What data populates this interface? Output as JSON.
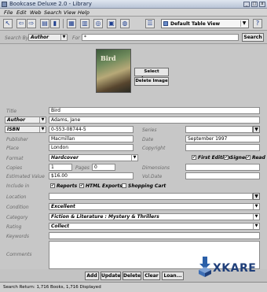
{
  "window": {
    "title": "Bookcase Deluxe 2.0 - Library",
    "min_symbol": "_",
    "max_symbol": "□",
    "close_symbol": "x"
  },
  "menu": [
    "File",
    "Edit",
    "Web",
    "Search",
    "View",
    "Help"
  ],
  "toolbar": {
    "buttons": [
      {
        "name": "pointer-icon",
        "glyph": "↖"
      },
      {
        "name": "back-arrow-icon",
        "glyph": "⇦"
      },
      {
        "name": "forward-arrow-icon",
        "glyph": "⇨"
      },
      {
        "name": "new-record-icon",
        "glyph": "▤"
      },
      {
        "name": "save-icon",
        "glyph": "▮"
      },
      {
        "name": "book-icon",
        "glyph": "▦"
      },
      {
        "name": "library-icon",
        "glyph": "▥"
      },
      {
        "name": "binoculars-icon",
        "glyph": "◎"
      },
      {
        "name": "stamp-icon",
        "glyph": "▣"
      },
      {
        "name": "web-icon",
        "glyph": "◍"
      },
      {
        "name": "list-icon",
        "glyph": "☰"
      },
      {
        "name": "help-icon",
        "glyph": "?"
      }
    ],
    "view_select": "Default Table View",
    "view_arrow": "▼"
  },
  "search": {
    "by_label": "Search By",
    "by_value": "Author",
    "for_label": "For",
    "for_value": "*",
    "button": "Search"
  },
  "cover": {
    "title_on_cover": "Bird",
    "select_button": "Select Image...",
    "delete_button": "Delete Image"
  },
  "form": {
    "title_label": "Title",
    "title_value": "Bird",
    "author_label": "Author",
    "author_value": "Adams, Jane",
    "isbn_label": "ISBN",
    "isbn_value": "0-553-08744-5",
    "series_label": "Series",
    "series_value": "",
    "publisher_label": "Publisher",
    "publisher_value": "Macmillan",
    "date_label": "Date",
    "date_value": "September 1997",
    "place_label": "Place",
    "place_value": "London",
    "copyright_label": "Copyright",
    "copyright_value": "",
    "format_label": "Format",
    "format_value": "Hardcover",
    "first_edition_label": "First Edition",
    "first_edition_checked": "✔",
    "signed_label": "Signed",
    "signed_checked": "✔",
    "read_label": "Read",
    "read_checked": "✔",
    "copies_label": "Copies",
    "copies_value": "1",
    "pages_label": "Pages",
    "pages_value": "0",
    "dimensions_label": "Dimensions",
    "dimensions_value": "",
    "estimated_label": "Estimated Value",
    "estimated_value": "$16.00",
    "voldate_label": "Vol.Date",
    "voldate_value": "",
    "include_label": "Include in",
    "reports_label": "Reports",
    "reports_checked": "✔",
    "html_label": "HTML Exports",
    "html_checked": "✔",
    "cart_label": "Shopping Cart",
    "cart_checked": "",
    "location_label": "Location",
    "location_value": "",
    "condition_label": "Condition",
    "condition_value": "Excellent",
    "category_label": "Category",
    "category_value": "Fiction & Literature : Mystery & Thrillers",
    "rating_label": "Rating",
    "rating_value": "Collect",
    "keywords_label": "Keywords",
    "keywords_value": "",
    "comments_label": "Comments",
    "comments_value": ""
  },
  "actions": [
    "Add",
    "Update",
    "Delete",
    "Clear",
    "Loan..."
  ],
  "status": "Search Return: 1,716 Books, 1,716 Displayed",
  "watermark": "XKARE",
  "colors": {
    "accent_blue": "#1f3f8f",
    "watermark_blue": "#1f3f7a"
  }
}
